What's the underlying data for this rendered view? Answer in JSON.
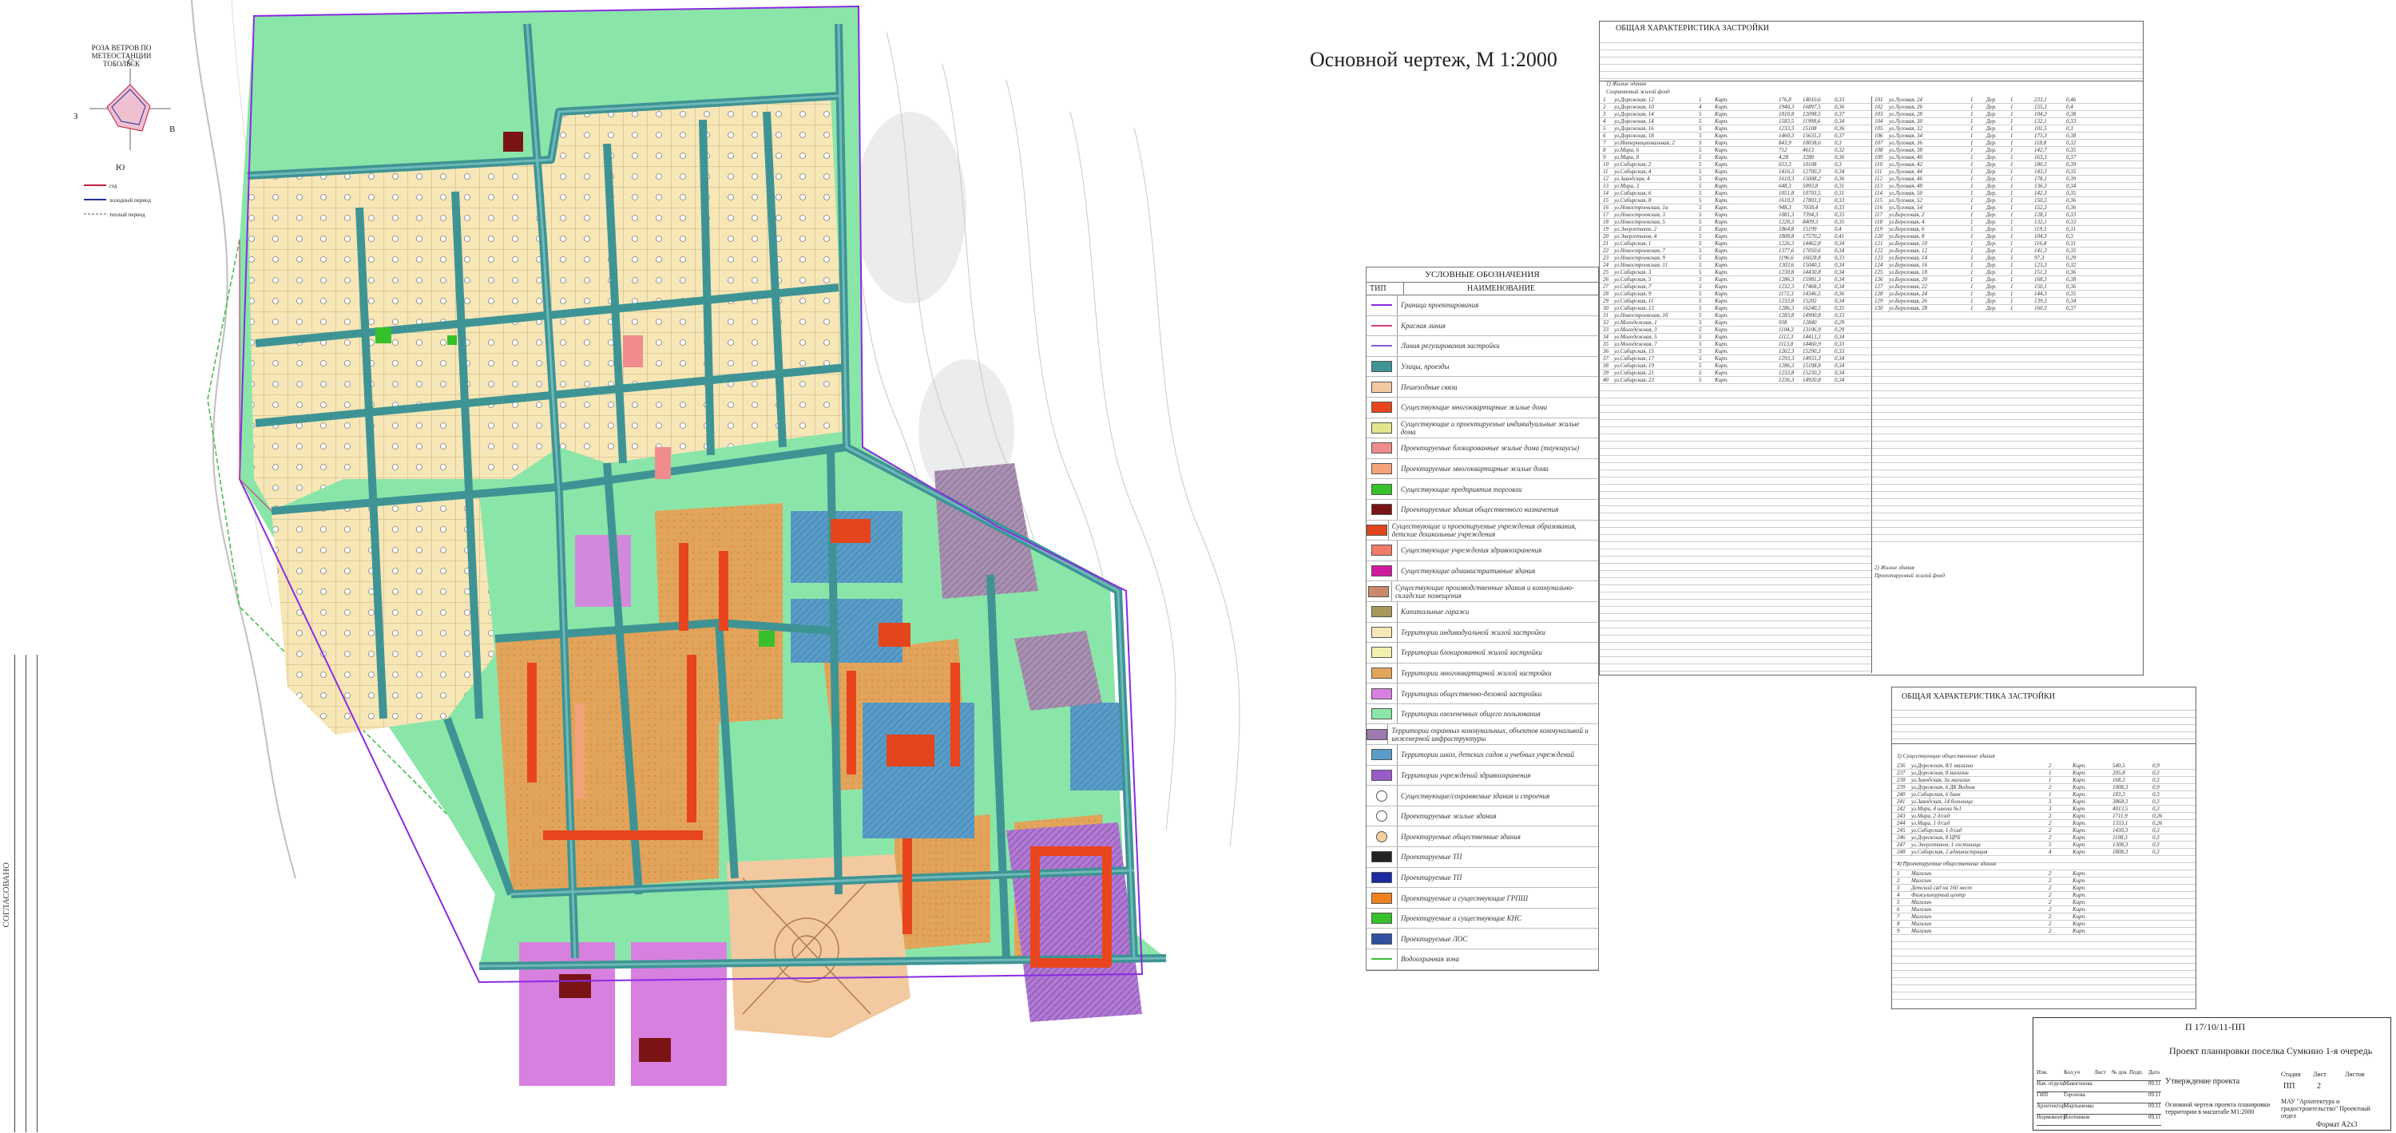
{
  "title": "Основной чертеж,  М 1:2000",
  "wind_rose": {
    "title": "РОЗА ВЕТРОВ ПО МЕТЕОСТАНЦИИ ТОБОЛЬСК",
    "dirs": {
      "n": "С",
      "s": "Ю",
      "w": "З",
      "e": "В"
    },
    "legend": [
      "год",
      "холодный период",
      "теплый период"
    ]
  },
  "legend": {
    "heading": "УСЛОВНЫЕ ОБОЗНАЧЕНИЯ",
    "col_type": "ТИП",
    "col_name": "НАИМЕНОВАНИЕ",
    "items": [
      {
        "label": "Граница проектирования",
        "kind": "line",
        "color": "#8a2be2"
      },
      {
        "label": "Красная линия",
        "kind": "line",
        "color": "#d04080"
      },
      {
        "label": "Линия регулирования застройки",
        "kind": "line",
        "color": "#8a5ad8"
      },
      {
        "label": "Улицы, проезды",
        "kind": "box",
        "color": "#3e9494"
      },
      {
        "label": "Пешеходные связи",
        "kind": "box",
        "color": "#f3c9a0"
      },
      {
        "label": "Существующие многоквартирные жилые дома",
        "kind": "box",
        "color": "#e8451e"
      },
      {
        "label": "Существующие и проектируемые индивидуальные жилые дома",
        "kind": "box",
        "color": "#e3e58a"
      },
      {
        "label": "Проектируемые блокированные жилые дома (таунхаусы)",
        "kind": "box",
        "color": "#f08c8c"
      },
      {
        "label": "Проектируемые многоквартирные жилые дома",
        "kind": "box",
        "color": "#f4a27a"
      },
      {
        "label": "Существующие предприятия торговли",
        "kind": "box",
        "color": "#36c12a"
      },
      {
        "label": "Проектируемые здания общественного назначения",
        "kind": "box",
        "color": "#7a1414"
      },
      {
        "label": "Существующие и проектируемые учреждения образования, детские дошкольные учреждения",
        "kind": "box",
        "color": "#e3461c"
      },
      {
        "label": "Существующие учреждения здравоохранения",
        "kind": "box",
        "color": "#f27a6a"
      },
      {
        "label": "Существующие административные здания",
        "kind": "box",
        "color": "#d01a9c"
      },
      {
        "label": "Существующие производственные здания и коммунально-складские помещения",
        "kind": "box",
        "color": "#c98a6a"
      },
      {
        "label": "Капитальные гаражи",
        "kind": "box",
        "color": "#a9985e"
      },
      {
        "label": "Территории индивидуальной жилой застройки",
        "kind": "box",
        "color": "#f7e6b6"
      },
      {
        "label": "Территории блокированной жилой застройки",
        "kind": "box",
        "color": "#f3efb0"
      },
      {
        "label": "Территории многоквартирной жилой застройки",
        "kind": "box",
        "color": "#e2a45a"
      },
      {
        "label": "Территории общественно-деловой застройки",
        "kind": "box",
        "color": "#d880e0"
      },
      {
        "label": "Территории озелененных общего пользования",
        "kind": "box",
        "color": "#8ae6a8"
      },
      {
        "label": "Территории охранных коммунальных, объектов коммунальной и инженерной инфраструктуры",
        "kind": "box",
        "color": "#9e7ab0"
      },
      {
        "label": "Территории школ, детских садов и учебных учреждений",
        "kind": "box",
        "color": "#5a9cc8"
      },
      {
        "label": "Территории учреждений здравоохранения",
        "kind": "box",
        "color": "#9a5ac8"
      },
      {
        "label": "Существующие/сохраняемые здания и строения",
        "kind": "circle",
        "color": "#ffffff"
      },
      {
        "label": "Проектируемые жилые здания",
        "kind": "circle",
        "color": "#ffffff"
      },
      {
        "label": "Проектируемые общественные здания",
        "kind": "circle",
        "color": "#f4d0a0"
      },
      {
        "label": "Проектируемые ТП",
        "kind": "box",
        "color": "#222222"
      },
      {
        "label": "Проектируемые ТП",
        "kind": "box",
        "color": "#1a2aa0"
      },
      {
        "label": "Проектируемые и существующие ГРПШ",
        "kind": "box",
        "color": "#f08020"
      },
      {
        "label": "Проектируемые и существующие КНС",
        "kind": "box",
        "color": "#36c12a"
      },
      {
        "label": "Проектируемые ЛОС",
        "kind": "box",
        "color": "#3050a0"
      },
      {
        "label": "Водоохранная зона",
        "kind": "line",
        "color": "#3cbf3c"
      }
    ]
  },
  "table1": {
    "title": "ОБЩАЯ ХАРАКТЕРИСТИКА ЗАСТРОЙКИ",
    "subs": [
      "1) Жилые здания",
      "Сохраняемый жилой фонд",
      "2) Жилые здания",
      "Проектируемый жилой фонд"
    ],
    "rows_left": [
      [
        "1",
        "ул.Дорожная, 12",
        "1",
        "Кирп.",
        "176,8",
        "14010,6",
        "0,33"
      ],
      [
        "2",
        "ул.Дорожная, 10",
        "4",
        "Кирп.",
        "1940,3",
        "16897,5",
        "0,36"
      ],
      [
        "3",
        "ул.Дорожная, 14",
        "5",
        "Кирп.",
        "1810,8",
        "12098,5",
        "0,37"
      ],
      [
        "4",
        "ул.Дорожная, 14",
        "5",
        "Кирп.",
        "1583,5",
        "11998,6",
        "0,34"
      ],
      [
        "5",
        "ул.Дорожная, 16",
        "5",
        "Кирп.",
        "1233,3",
        "15108",
        "0,36"
      ],
      [
        "6",
        "ул.Дорожная, 18",
        "5",
        "Кирп.",
        "1460,3",
        "15635,3",
        "0,37"
      ],
      [
        "7",
        "ул.Интернациональная, 2",
        "5",
        "Кирп.",
        "843,9",
        "10038,6",
        "0,3"
      ],
      [
        "8",
        "ул.Мира, 6",
        "5",
        "Кирп.",
        "712",
        "4613",
        "0,32"
      ],
      [
        "9",
        "ул.Мира, 8",
        "5",
        "Кирп.",
        "4,28",
        "3288",
        "0,36"
      ],
      [
        "10",
        "ул.Сибирская, 2",
        "5",
        "Кирп.",
        "653,3",
        "10108",
        "0,3"
      ],
      [
        "11",
        "ул.Сибирская, 4",
        "5",
        "Кирп.",
        "1416,3",
        "12700,3",
        "0,34"
      ],
      [
        "12",
        "ул.Заводская, 4",
        "5",
        "Кирп.",
        "1610,3",
        "15008,2",
        "0,36"
      ],
      [
        "13",
        "ул.Мира, 3",
        "5",
        "Кирп.",
        "648,3",
        "5093,8",
        "0,31"
      ],
      [
        "14",
        "ул.Сибирская, 6",
        "5",
        "Кирп.",
        "1051,8",
        "10703,5",
        "0,31"
      ],
      [
        "15",
        "ул.Сибирская, 8",
        "5",
        "Кирп.",
        "1610,3",
        "17803,3",
        "0,33"
      ],
      [
        "16",
        "ул.Новостроевская, 1а",
        "5",
        "Кирп.",
        "948,3",
        "7038,4",
        "0,33"
      ],
      [
        "17",
        "ул.Новостроевская, 3",
        "5",
        "Кирп.",
        "1081,3",
        "7394,3",
        "0,33"
      ],
      [
        "18",
        "ул.Новостроевская, 5",
        "5",
        "Кирп.",
        "1228,3",
        "8409,3",
        "0,35"
      ],
      [
        "19",
        "ул.Энергетиков, 2",
        "5",
        "Кирп.",
        "1864,8",
        "15199",
        "0,4"
      ],
      [
        "20",
        "ул.Энергетиков, 4",
        "5",
        "Кирп.",
        "1808,8",
        "17570,2",
        "0,41"
      ],
      [
        "21",
        "ул.Сибирская, 1",
        "5",
        "Кирп.",
        "1226,3",
        "14462,8",
        "0,34"
      ],
      [
        "22",
        "ул.Новостроевская, 7",
        "5",
        "Кирп.",
        "1377,6",
        "17050,6",
        "0,34"
      ],
      [
        "23",
        "ул.Новостроевская, 9",
        "5",
        "Кирп.",
        "1196,6",
        "16028,8",
        "0,33"
      ],
      [
        "24",
        "ул.Новостроевская, 11",
        "5",
        "Кирп.",
        "1303,6",
        "15040,5",
        "0,34"
      ],
      [
        "25",
        "ул.Сибирская, 3",
        "5",
        "Кирп.",
        "1230,8",
        "14430,8",
        "0,34"
      ],
      [
        "26",
        "ул.Сибирская, 5",
        "5",
        "Кирп.",
        "1286,3",
        "15981,3",
        "0,34"
      ],
      [
        "27",
        "ул.Сибирская, 7",
        "5",
        "Кирп.",
        "1232,3",
        "17468,3",
        "0,34"
      ],
      [
        "28",
        "ул.Сибирская, 9",
        "5",
        "Кирп.",
        "1172,3",
        "14346,5",
        "0,36"
      ],
      [
        "29",
        "ул.Сибирская, 11",
        "5",
        "Кирп.",
        "1233,8",
        "15202",
        "0,34"
      ],
      [
        "30",
        "ул.Сибирская, 13",
        "5",
        "Кирп.",
        "1286,3",
        "16240,5",
        "0,35"
      ],
      [
        "31",
        "ул.Новостроевская, 1б",
        "5",
        "Кирп.",
        "1283,8",
        "14900,8",
        "0,33"
      ],
      [
        "32",
        "ул.Молодежная, 1",
        "5",
        "Кирп.",
        "938",
        "12840",
        "0,29"
      ],
      [
        "33",
        "ул.Молодежная, 3",
        "5",
        "Кирп.",
        "1104,3",
        "13106,9",
        "0,29"
      ],
      [
        "34",
        "ул.Молодежная, 5",
        "5",
        "Кирп.",
        "1112,3",
        "14413,3",
        "0,34"
      ],
      [
        "35",
        "ул.Молодежная, 7",
        "5",
        "Кирп.",
        "1113,8",
        "14460,9",
        "0,33"
      ],
      [
        "36",
        "ул.Сибирская, 15",
        "5",
        "Кирп.",
        "1262,3",
        "15290,3",
        "0,33"
      ],
      [
        "37",
        "ул.Сибирская, 17",
        "5",
        "Кирп.",
        "1293,3",
        "14933,3",
        "0,34"
      ],
      [
        "38",
        "ул.Сибирская, 19",
        "5",
        "Кирп.",
        "1286,3",
        "15198,8",
        "0,34"
      ],
      [
        "39",
        "ул.Сибирская, 21",
        "5",
        "Кирп.",
        "1233,8",
        "15230,3",
        "0,34"
      ],
      [
        "40",
        "ул.Сибирская, 23",
        "5",
        "Кирп.",
        "1236,3",
        "14920,8",
        "0,34"
      ]
    ],
    "rows_right": [
      [
        "101",
        "ул.Луговая, 24",
        "1",
        "Дер.",
        "1",
        "233,1",
        "0,46"
      ],
      [
        "102",
        "ул.Луговая, 26",
        "1",
        "Дер.",
        "1",
        "155,3",
        "0,4"
      ],
      [
        "103",
        "ул.Луговая, 28",
        "1",
        "Дер.",
        "1",
        "104,2",
        "0,38"
      ],
      [
        "104",
        "ул.Луговая, 30",
        "1",
        "Дер.",
        "1",
        "132,1",
        "0,33"
      ],
      [
        "105",
        "ул.Луговая, 32",
        "1",
        "Дер.",
        "1",
        "101,5",
        "0,3"
      ],
      [
        "106",
        "ул.Луговая, 34",
        "1",
        "Дер.",
        "1",
        "173,3",
        "0,38"
      ],
      [
        "107",
        "ул.Луговая, 36",
        "1",
        "Дер.",
        "1",
        "118,8",
        "0,32"
      ],
      [
        "108",
        "ул.Луговая, 38",
        "1",
        "Дер.",
        "1",
        "142,7",
        "0,35"
      ],
      [
        "109",
        "ул.Луговая, 40",
        "1",
        "Дер.",
        "1",
        "163,3",
        "0,37"
      ],
      [
        "110",
        "ул.Луговая, 42",
        "1",
        "Дер.",
        "1",
        "180,3",
        "0,39"
      ],
      [
        "111",
        "ул.Луговая, 44",
        "1",
        "Дер.",
        "1",
        "143,3",
        "0,35"
      ],
      [
        "112",
        "ул.Луговая, 46",
        "1",
        "Дер.",
        "1",
        "178,1",
        "0,39"
      ],
      [
        "113",
        "ул.Луговая, 48",
        "1",
        "Дер.",
        "1",
        "136,3",
        "0,34"
      ],
      [
        "114",
        "ул.Луговая, 50",
        "1",
        "Дер.",
        "1",
        "142,3",
        "0,35"
      ],
      [
        "115",
        "ул.Луговая, 52",
        "1",
        "Дер.",
        "1",
        "150,3",
        "0,36"
      ],
      [
        "116",
        "ул.Луговая, 54",
        "1",
        "Дер.",
        "1",
        "152,3",
        "0,36"
      ],
      [
        "117",
        "ул.Береговая, 2",
        "1",
        "Дер.",
        "1",
        "128,3",
        "0,33"
      ],
      [
        "118",
        "ул.Береговая, 4",
        "1",
        "Дер.",
        "1",
        "132,1",
        "0,33"
      ],
      [
        "119",
        "ул.Береговая, 6",
        "1",
        "Дер.",
        "1",
        "119,3",
        "0,31"
      ],
      [
        "120",
        "ул.Береговая, 8",
        "1",
        "Дер.",
        "1",
        "104,3",
        "0,3"
      ],
      [
        "121",
        "ул.Береговая, 10",
        "1",
        "Дер.",
        "1",
        "116,4",
        "0,31"
      ],
      [
        "122",
        "ул.Береговая, 12",
        "1",
        "Дер.",
        "1",
        "141,3",
        "0,35"
      ],
      [
        "123",
        "ул.Береговая, 14",
        "1",
        "Дер.",
        "1",
        "97,3",
        "0,29"
      ],
      [
        "124",
        "ул.Береговая, 16",
        "1",
        "Дер.",
        "1",
        "123,3",
        "0,32"
      ],
      [
        "125",
        "ул.Береговая, 18",
        "1",
        "Дер.",
        "1",
        "151,3",
        "0,36"
      ],
      [
        "126",
        "ул.Береговая, 20",
        "1",
        "Дер.",
        "1",
        "168,3",
        "0,38"
      ],
      [
        "127",
        "ул.Береговая, 22",
        "1",
        "Дер.",
        "1",
        "150,1",
        "0,36"
      ],
      [
        "128",
        "ул.Береговая, 24",
        "1",
        "Дер.",
        "1",
        "144,3",
        "0,35"
      ],
      [
        "129",
        "ул.Береговая, 26",
        "1",
        "Дер.",
        "1",
        "139,3",
        "0,34"
      ],
      [
        "130",
        "ул.Береговая, 28",
        "1",
        "Дер.",
        "1",
        "160,3",
        "0,37"
      ]
    ]
  },
  "table2": {
    "title": "ОБЩАЯ ХАРАКТЕРИСТИКА ЗАСТРОЙКИ",
    "sub1": "3) Существующие общественные здания",
    "sub2": "4) Проектируемые общественные здания",
    "rows": [
      [
        "236",
        "ул.Дорожная, 8/1 магазин",
        "2",
        "Кирп.",
        "540,5",
        "0,9"
      ],
      [
        "237",
        "ул.Дорожная, 8 магазин",
        "1",
        "Кирп.",
        "205,8",
        "0,3"
      ],
      [
        "238",
        "ул.Заводская, 3а магазин",
        "1",
        "Кирп.",
        "168,3",
        "0,3"
      ],
      [
        "239",
        "ул.Дорожная, 6 ДК Водник",
        "2",
        "Кирп.",
        "1008,3",
        "0,9"
      ],
      [
        "240",
        "ул.Сибирская, 6 банк",
        "1",
        "Кирп.",
        "183,3",
        "0,3"
      ],
      [
        "241",
        "ул.Заводская, 14 больница",
        "3",
        "Кирп.",
        "3868,3",
        "0,3"
      ],
      [
        "242",
        "ул.Мира, 4 школа №1",
        "3",
        "Кирп.",
        "4013,5",
        "0,3"
      ],
      [
        "243",
        "ул.Мира, 2 д/сад",
        "2",
        "Кирп.",
        "1711,9",
        "0,26"
      ],
      [
        "244",
        "ул.Мира, 1 д/сад",
        "2",
        "Кирп.",
        "1333,1",
        "0,26"
      ],
      [
        "245",
        "ул.Сибирская, 1 д/сад",
        "2",
        "Кирп.",
        "1430,3",
        "0,3"
      ],
      [
        "246",
        "ул.Дорожная, 8 ЦРБ",
        "2",
        "Кирп.",
        "1108,3",
        "0,3"
      ],
      [
        "247",
        "ул.Энергетиков, 1 гостиница",
        "5",
        "Кирп.",
        "1308,3",
        "0,3"
      ],
      [
        "248",
        "ул.Сибирская, 2 администрация",
        "4",
        "Кирп.",
        "1808,3",
        "0,3"
      ]
    ],
    "rows2": [
      [
        "1",
        "Магазин",
        "2",
        "Кирп."
      ],
      [
        "2",
        "Магазин",
        "2",
        "Кирп."
      ],
      [
        "3",
        "Детский сад на 160 мест",
        "2",
        "Кирп."
      ],
      [
        "4",
        "Физкультурный центр",
        "2",
        "Кирп."
      ],
      [
        "5",
        "Магазин",
        "2",
        "Кирп."
      ],
      [
        "6",
        "Магазин",
        "2",
        "Кирп."
      ],
      [
        "7",
        "Магазин",
        "2",
        "Кирп."
      ],
      [
        "8",
        "Магазин",
        "2",
        "Кирп."
      ],
      [
        "9",
        "Магазин",
        "2",
        "Кирп."
      ]
    ]
  },
  "stamp": {
    "code": "П 17/10/11-ПП",
    "project": "Проект планировки поселка Сумкино 1-я очередь",
    "stage_title": "Утверждение проекта",
    "stage_head": [
      "Стадия",
      "Лист",
      "Листов"
    ],
    "stage_vals": [
      "ПП",
      "2",
      ""
    ],
    "sheet_desc": "Основной чертеж проекта планировки территории в масштабе М1:2000",
    "org": "МАУ \"Архитектура и градостроительство\" Проектный отдел",
    "format": "Формат  А2х3",
    "staff": [
      [
        "Изм.",
        "Кол.уч",
        "Лист",
        "№ док",
        "Подп.",
        "Дата"
      ],
      [
        "Нач. отдела",
        "Макогонова",
        "",
        "",
        "",
        "09.11"
      ],
      [
        "ГИП",
        "Горохова",
        "",
        "",
        "",
        "09.11"
      ],
      [
        "Архитектор",
        "Мартыненко",
        "",
        "",
        "",
        "09.11"
      ],
      [
        "Нормоконтр.",
        "Плотников",
        "",
        "",
        "",
        "09.11"
      ]
    ]
  },
  "side_stamp_text": "СОГЛАСОВАНО"
}
